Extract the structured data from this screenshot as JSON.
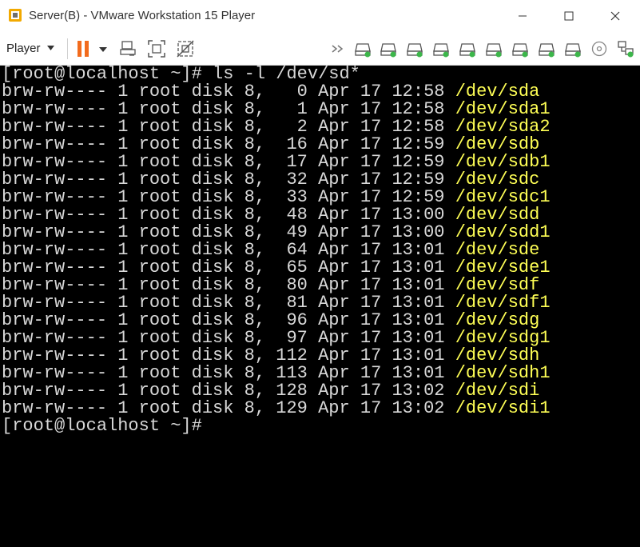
{
  "window": {
    "title": "Server(B) - VMware Workstation 15 Player"
  },
  "toolbar": {
    "player_label": "Player"
  },
  "terminal": {
    "command_prompt": "[root@localhost ~]# ",
    "command": "ls -l /dev/sd*",
    "rows": [
      {
        "perm": "brw-rw----",
        "links": "1",
        "owner": "root",
        "group": "disk",
        "major": "8,",
        "minor": "0",
        "month": "Apr",
        "day": "17",
        "time": "12:58",
        "name": "/dev/sda"
      },
      {
        "perm": "brw-rw----",
        "links": "1",
        "owner": "root",
        "group": "disk",
        "major": "8,",
        "minor": "1",
        "month": "Apr",
        "day": "17",
        "time": "12:58",
        "name": "/dev/sda1"
      },
      {
        "perm": "brw-rw----",
        "links": "1",
        "owner": "root",
        "group": "disk",
        "major": "8,",
        "minor": "2",
        "month": "Apr",
        "day": "17",
        "time": "12:58",
        "name": "/dev/sda2"
      },
      {
        "perm": "brw-rw----",
        "links": "1",
        "owner": "root",
        "group": "disk",
        "major": "8,",
        "minor": "16",
        "month": "Apr",
        "day": "17",
        "time": "12:59",
        "name": "/dev/sdb"
      },
      {
        "perm": "brw-rw----",
        "links": "1",
        "owner": "root",
        "group": "disk",
        "major": "8,",
        "minor": "17",
        "month": "Apr",
        "day": "17",
        "time": "12:59",
        "name": "/dev/sdb1"
      },
      {
        "perm": "brw-rw----",
        "links": "1",
        "owner": "root",
        "group": "disk",
        "major": "8,",
        "minor": "32",
        "month": "Apr",
        "day": "17",
        "time": "12:59",
        "name": "/dev/sdc"
      },
      {
        "perm": "brw-rw----",
        "links": "1",
        "owner": "root",
        "group": "disk",
        "major": "8,",
        "minor": "33",
        "month": "Apr",
        "day": "17",
        "time": "12:59",
        "name": "/dev/sdc1"
      },
      {
        "perm": "brw-rw----",
        "links": "1",
        "owner": "root",
        "group": "disk",
        "major": "8,",
        "minor": "48",
        "month": "Apr",
        "day": "17",
        "time": "13:00",
        "name": "/dev/sdd"
      },
      {
        "perm": "brw-rw----",
        "links": "1",
        "owner": "root",
        "group": "disk",
        "major": "8,",
        "minor": "49",
        "month": "Apr",
        "day": "17",
        "time": "13:00",
        "name": "/dev/sdd1"
      },
      {
        "perm": "brw-rw----",
        "links": "1",
        "owner": "root",
        "group": "disk",
        "major": "8,",
        "minor": "64",
        "month": "Apr",
        "day": "17",
        "time": "13:01",
        "name": "/dev/sde"
      },
      {
        "perm": "brw-rw----",
        "links": "1",
        "owner": "root",
        "group": "disk",
        "major": "8,",
        "minor": "65",
        "month": "Apr",
        "day": "17",
        "time": "13:01",
        "name": "/dev/sde1"
      },
      {
        "perm": "brw-rw----",
        "links": "1",
        "owner": "root",
        "group": "disk",
        "major": "8,",
        "minor": "80",
        "month": "Apr",
        "day": "17",
        "time": "13:01",
        "name": "/dev/sdf"
      },
      {
        "perm": "brw-rw----",
        "links": "1",
        "owner": "root",
        "group": "disk",
        "major": "8,",
        "minor": "81",
        "month": "Apr",
        "day": "17",
        "time": "13:01",
        "name": "/dev/sdf1"
      },
      {
        "perm": "brw-rw----",
        "links": "1",
        "owner": "root",
        "group": "disk",
        "major": "8,",
        "minor": "96",
        "month": "Apr",
        "day": "17",
        "time": "13:01",
        "name": "/dev/sdg"
      },
      {
        "perm": "brw-rw----",
        "links": "1",
        "owner": "root",
        "group": "disk",
        "major": "8,",
        "minor": "97",
        "month": "Apr",
        "day": "17",
        "time": "13:01",
        "name": "/dev/sdg1"
      },
      {
        "perm": "brw-rw----",
        "links": "1",
        "owner": "root",
        "group": "disk",
        "major": "8,",
        "minor": "112",
        "month": "Apr",
        "day": "17",
        "time": "13:01",
        "name": "/dev/sdh"
      },
      {
        "perm": "brw-rw----",
        "links": "1",
        "owner": "root",
        "group": "disk",
        "major": "8,",
        "minor": "113",
        "month": "Apr",
        "day": "17",
        "time": "13:01",
        "name": "/dev/sdh1"
      },
      {
        "perm": "brw-rw----",
        "links": "1",
        "owner": "root",
        "group": "disk",
        "major": "8,",
        "minor": "128",
        "month": "Apr",
        "day": "17",
        "time": "13:02",
        "name": "/dev/sdi"
      },
      {
        "perm": "brw-rw----",
        "links": "1",
        "owner": "root",
        "group": "disk",
        "major": "8,",
        "minor": "129",
        "month": "Apr",
        "day": "17",
        "time": "13:02",
        "name": "/dev/sdi1"
      }
    ],
    "final_prompt": "[root@localhost ~]#"
  },
  "colors": {
    "terminal_bg": "#000000",
    "terminal_text": "#d8d8d8",
    "device_name": "#ffff55",
    "pause_orange": "#f26b1d",
    "device_led_green": "#3cb64a"
  },
  "icons": [
    "vmware-app-icon",
    "minimize-icon",
    "maximize-icon",
    "close-icon",
    "player-dropdown-icon",
    "pause-icon",
    "pause-dropdown-icon",
    "send-ctrl-alt-del-icon",
    "fit-guest-icon",
    "unity-icon",
    "more-devices-icon",
    "hard-disk-icon",
    "cd-dvd-icon",
    "network-adapter-icon"
  ]
}
